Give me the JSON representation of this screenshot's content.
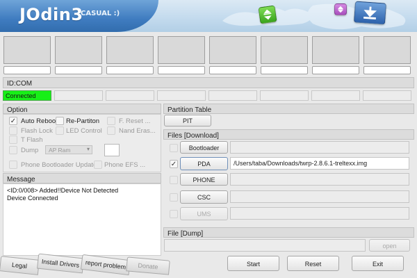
{
  "app": {
    "title": "JOdin3",
    "subtitle": "CASUAL :)"
  },
  "ports": {
    "count": 8,
    "id_com_label": "ID:COM",
    "status": "Connected",
    "status_color": "#17ef17"
  },
  "option": {
    "title": "Option",
    "items": {
      "auto_reboot": {
        "label": "Auto Reboo",
        "checked": true
      },
      "re_partition": {
        "label": "Re-Partiton",
        "checked": false
      },
      "f_reset": {
        "label": "F. Reset ...",
        "checked": false
      },
      "flash_lock": {
        "label": "Flash Lock",
        "checked": false
      },
      "led_control": {
        "label": "LED Control",
        "checked": false
      },
      "nand_erase": {
        "label": "Nand Eras...",
        "checked": false
      },
      "t_flash": {
        "label": "T Flash",
        "checked": false
      },
      "dump": {
        "label": "Dump",
        "checked": false
      },
      "phone_bootloader_update": {
        "label": "Phone Bootloader Update",
        "checked": false
      },
      "phone_efs": {
        "label": "Phone EFS ...",
        "checked": false
      }
    },
    "dump_combo": "AP Ram"
  },
  "message": {
    "title": "Message",
    "lines": [
      "<ID:0/008> Added!!Device Not Detected",
      "Device Connected"
    ]
  },
  "partition_table": {
    "title": "Partition Table",
    "pit_label": "PIT"
  },
  "files": {
    "title": "Files [Download]",
    "bootloader": {
      "label": "Bootloader",
      "path": ""
    },
    "pda": {
      "label": "PDA",
      "checked": true,
      "path": "/Users/taba/Downloads/twrp-2.8.6.1-treltexx.img"
    },
    "phone": {
      "label": "PHONE",
      "path": ""
    },
    "csc": {
      "label": "CSC",
      "path": ""
    },
    "ums": {
      "label": "UMS",
      "path": ""
    }
  },
  "dump": {
    "title": "File [Dump]",
    "open_label": "open"
  },
  "tabs": [
    "Legal",
    "Install Drivers",
    "report problem",
    "Donate"
  ],
  "actions": {
    "start": "Start",
    "reset": "Reset",
    "exit": "Exit"
  },
  "colors": {
    "header_blue": "#3f7cc0",
    "connected_green": "#17ef17",
    "panel_bg": "#dcdcdc"
  }
}
